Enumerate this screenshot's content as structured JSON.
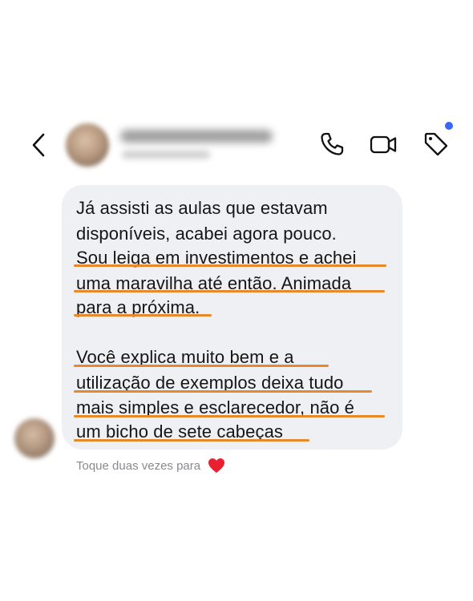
{
  "header": {
    "contact_name": "",
    "contact_handle": "",
    "icons": {
      "back": "chevron-left-icon",
      "call": "phone-icon",
      "video": "video-camera-icon",
      "tag": "tag-icon"
    },
    "notification_dot_color": "#3b66f5"
  },
  "message": {
    "lines": [
      "Já assisti as aulas que estavam",
      "disponíveis, acabei agora pouco.",
      "Sou leiga em investimentos e achei",
      "uma maravilha até então. Animada",
      "para a próxima.",
      "Você explica muito bem e a",
      "utilização de exemplos deixa tudo",
      "mais simples e esclarecedor, não é",
      "um bicho de sete cabeças"
    ],
    "highlight_color": "#e7892a",
    "bubble_color": "#eff0f4"
  },
  "reaction_hint": {
    "text": "Toque duas vezes para",
    "icon": "heart-icon",
    "icon_color": "#e8202f"
  }
}
